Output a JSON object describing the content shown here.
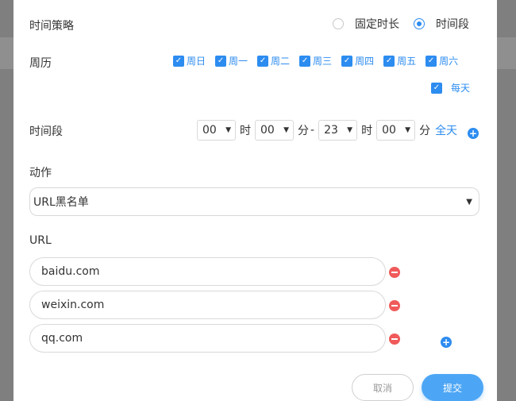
{
  "form": {
    "time_strategy": {
      "label": "时间策略",
      "options": [
        {
          "label": "固定时长",
          "selected": false
        },
        {
          "label": "时间段",
          "selected": true
        }
      ]
    },
    "calendar": {
      "label": "周历",
      "days": [
        {
          "label": "周日",
          "checked": true
        },
        {
          "label": "周一",
          "checked": true
        },
        {
          "label": "周二",
          "checked": true
        },
        {
          "label": "周三",
          "checked": true
        },
        {
          "label": "周四",
          "checked": true
        },
        {
          "label": "周五",
          "checked": true
        },
        {
          "label": "周六",
          "checked": true
        }
      ],
      "everyday": {
        "label": "每天",
        "checked": true
      }
    },
    "time_period": {
      "label": "时间段",
      "start_hour": "00",
      "start_minute": "00",
      "end_hour": "23",
      "end_minute": "00",
      "hour_unit": "时",
      "minute_unit": "分",
      "separator": "-",
      "all_day_label": "全天",
      "add_icon": "plus-circle-icon"
    },
    "action": {
      "label": "动作",
      "selected": "URL黑名单"
    },
    "url": {
      "label": "URL",
      "entries": [
        "baidu.com",
        "weixin.com",
        "qq.com"
      ],
      "remove_icon": "minus-circle-icon",
      "add_icon": "plus-circle-icon"
    },
    "buttons": {
      "cancel": "取消",
      "submit": "提交"
    }
  },
  "colors": {
    "accent": "#2d8cf0",
    "submit": "#4da6f5",
    "danger": "#f05a5a",
    "overlay": "#8a8a8a"
  }
}
